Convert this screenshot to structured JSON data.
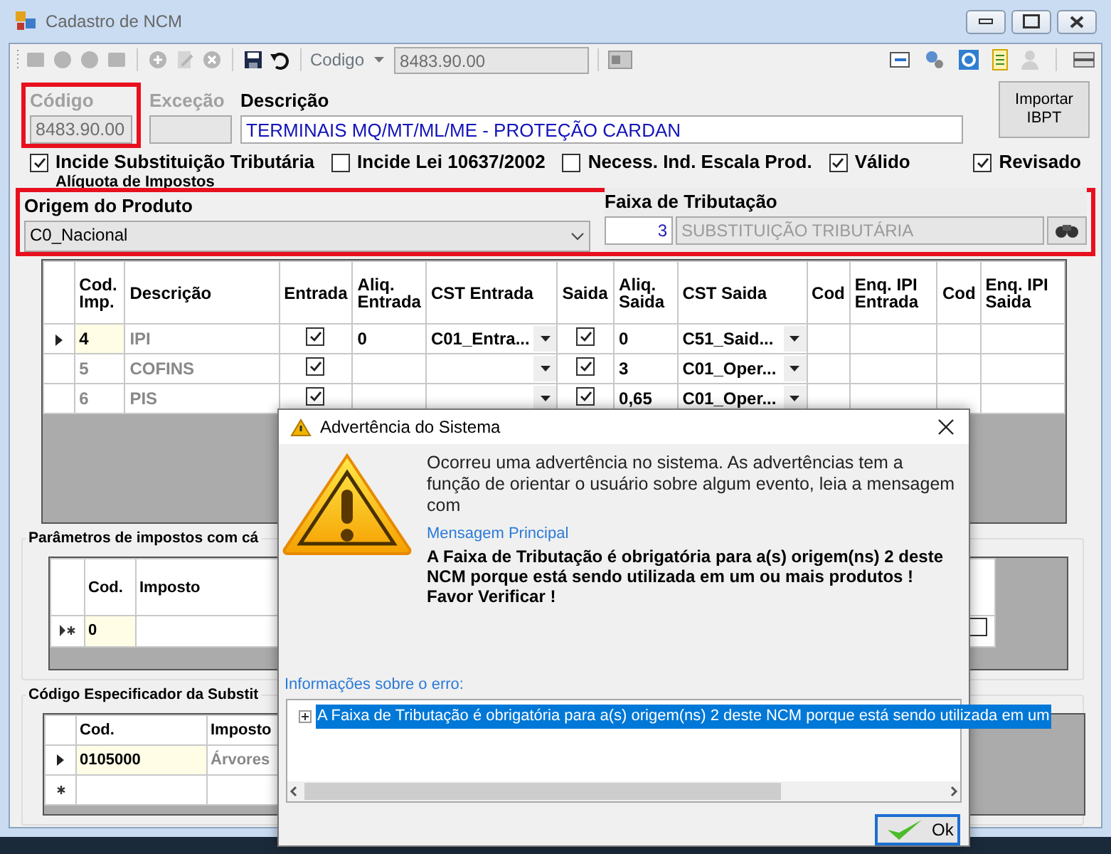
{
  "window": {
    "title": "Cadastro de NCM"
  },
  "toolbar": {
    "search_label": "Codigo",
    "search_value": "8483.90.00"
  },
  "header": {
    "codigo_label": "Código",
    "codigo_value": "8483.90.00",
    "codigo_disabled": true,
    "excecao_label": "Exceção",
    "excecao_disabled": true,
    "descricao_label": "Descrição",
    "descricao_value": "TERMINAIS MQ/MT/ML/ME - PROTEÇÃO CARDAN",
    "import_button": "Importar IBPT"
  },
  "checkboxes": [
    {
      "label": "Incide Substituição Tributária",
      "checked": true
    },
    {
      "label": "Incide Lei 10637/2002",
      "checked": false
    },
    {
      "label": "Necess. Ind. Escala Prod.",
      "checked": false
    },
    {
      "label": "Válido",
      "checked": true
    },
    {
      "label": "Revisado",
      "checked": true
    }
  ],
  "aliquota": {
    "group_title": "Alíquota de Impostos",
    "origem_label": "Origem do Produto",
    "origem_value": "C0_Nacional",
    "faixa_label": "Faixa de Tributação",
    "faixa_code": "3",
    "faixa_name": "SUBSTITUIÇÃO TRIBUTÁRIA"
  },
  "tax_grid": {
    "columns": [
      "Cod. Imp.",
      "Descrição",
      "Entrada",
      "Aliq. Entrada",
      "CST Entrada",
      "Saida",
      "Aliq. Saida",
      "CST Saida",
      "Cod",
      "Enq. IPI Entrada",
      "Cod",
      "Enq. IPI Saida"
    ],
    "rows": [
      {
        "selected": true,
        "cod": "4",
        "descricao": "IPI",
        "entrada": true,
        "aliq_entrada": "0",
        "cst_entrada": "C01_Entra...",
        "saida": true,
        "aliq_saida": "0",
        "cst_saida": "C51_Said..."
      },
      {
        "selected": false,
        "cod": "5",
        "descricao": "COFINS",
        "entrada": true,
        "saida": true,
        "aliq_saida": "3",
        "cst_saida": "C01_Oper..."
      },
      {
        "selected": false,
        "cod": "6",
        "descricao": "PIS",
        "entrada": true,
        "saida": true,
        "aliq_saida": "0,65",
        "cst_saida": "C01_Oper..."
      }
    ]
  },
  "params_section": {
    "title": "Parâmetros de impostos com cá",
    "columns": [
      "Cod.",
      "Imposto"
    ],
    "rows": [
      {
        "new": true,
        "cod": "0",
        "flag_checked": false
      }
    ]
  },
  "especificador_section": {
    "title": "Código Especificador da Substit",
    "columns": [
      "Cod.",
      "Imposto"
    ],
    "rows": [
      {
        "new": false,
        "cod": "0105000",
        "imposto": "Árvores"
      },
      {
        "new": true
      }
    ]
  },
  "dialog": {
    "title": "Advertência do Sistema",
    "intro": "Ocorreu uma advertência no sistema. As advertências tem a função de orientar o usuário sobre algum evento, leia a mensagem com",
    "main_label": "Mensagem Principal",
    "main_message": "A Faixa de Tributação é obrigatória para a(s) origem(ns) 2 deste NCM porque está sendo utilizada em um ou mais produtos !",
    "main_footer": "Favor Verificar !",
    "details_label": "Informações sobre o erro:",
    "details_items": [
      {
        "text": "A Faixa de Tributação é obrigatória para a(s) origem(ns) 2 deste NCM porque está sendo utilizada em um",
        "selected": true,
        "expanded": false
      }
    ],
    "ok_button": "Ok"
  }
}
